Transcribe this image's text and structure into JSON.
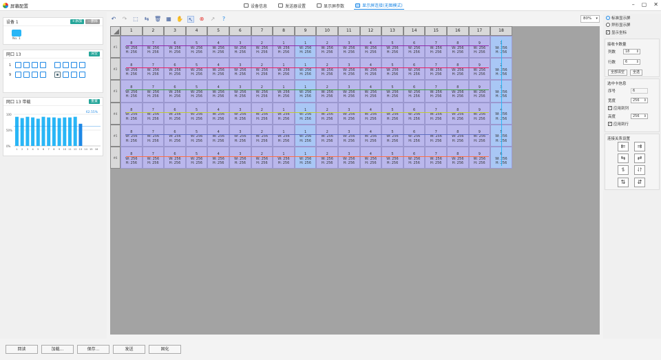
{
  "app": {
    "title": "屏幕配置"
  },
  "tabs": [
    {
      "label": "设备信息",
      "icon": "info-icon"
    },
    {
      "label": "发送器设置",
      "icon": "sender-icon"
    },
    {
      "label": "显示屏参数",
      "icon": "display-params-icon"
    },
    {
      "label": "显示屏连接(无图模式)",
      "icon": "display-connect-icon",
      "active": true
    }
  ],
  "left": {
    "device_card": {
      "title": "设备 1",
      "add_label": "+添加",
      "delete_label": "—删除",
      "device_label": "No. 1"
    },
    "port_card": {
      "title": "网口 13",
      "clear_label": "清空",
      "rows": [
        {
          "label": "1"
        },
        {
          "label": "9"
        }
      ]
    },
    "bandwidth_card": {
      "title": "网口 13 带载",
      "btn_label": "重置",
      "percent": "62.55%",
      "y_ticks": [
        "100",
        "50%",
        "0%"
      ],
      "x_ticks": [
        "1",
        "2",
        "3",
        "4",
        "5",
        "6",
        "7",
        "8",
        "9",
        "10",
        "11",
        "12",
        "13",
        "14",
        "15",
        "16"
      ]
    }
  },
  "toolbar": {
    "tools": [
      "undo-icon",
      "redo-icon",
      "select-area-icon",
      "auto-route-icon",
      "delete-icon",
      "layout-icon",
      "hand-icon",
      "pointer-icon",
      "clear-icon",
      "route-arrow-icon",
      "help-icon"
    ],
    "zoom": "80%"
  },
  "grid": {
    "columns": [
      "1",
      "2",
      "3",
      "4",
      "5",
      "6",
      "7",
      "8",
      "9",
      "10",
      "11",
      "12",
      "13",
      "14",
      "15",
      "16",
      "17",
      "18"
    ],
    "rows": [
      "#1",
      "#2",
      "#3",
      "#4",
      "#5",
      "#6"
    ],
    "cell_w_label": "W: 256",
    "cell_h_label": "H: 256",
    "row_numbers": [
      [
        "8",
        "7",
        "6",
        "5",
        "4",
        "3",
        "2",
        "1",
        "1",
        "2",
        "3",
        "4",
        "5",
        "6",
        "7",
        "8",
        "9",
        "1"
      ],
      [
        "8",
        "7",
        "6",
        "5",
        "4",
        "3",
        "2",
        "1",
        "1",
        "2",
        "3",
        "4",
        "5",
        "6",
        "7",
        "8",
        "9",
        "2"
      ],
      [
        "8",
        "7",
        "6",
        "5",
        "4",
        "3",
        "2",
        "1",
        "1",
        "2",
        "3",
        "4",
        "5",
        "6",
        "7",
        "8",
        "9",
        "3"
      ],
      [
        "8",
        "7",
        "6",
        "5",
        "4",
        "3",
        "2",
        "1",
        "1",
        "2",
        "3",
        "4",
        "5",
        "6",
        "7",
        "8",
        "9",
        "4"
      ],
      [
        "8",
        "7",
        "6",
        "5",
        "4",
        "3",
        "2",
        "1",
        "1",
        "2",
        "3",
        "4",
        "5",
        "6",
        "7",
        "8",
        "9",
        "5"
      ],
      [
        "8",
        "7",
        "6",
        "5",
        "4",
        "3",
        "2",
        "1",
        "1",
        "2",
        "3",
        "4",
        "5",
        "6",
        "7",
        "8",
        "9",
        "6"
      ]
    ]
  },
  "right": {
    "mode_standard": "标准显示屏",
    "mode_irregular": "异形显示屏",
    "show_grid": "显示坐标",
    "receiver_count": {
      "title": "接收卡数量",
      "cols_label": "列数",
      "cols_value": "18",
      "rows_label": "行数",
      "rows_value": "6",
      "clear_all": "全部清空",
      "select_all": "全选"
    },
    "selected_info": {
      "title": "选中卡信息",
      "index_label": "序号",
      "index_value": "6",
      "width_label": "宽度",
      "width_value": "256",
      "apply_col": "应用到列",
      "height_label": "高度",
      "height_value": "256",
      "apply_row": "应用到行"
    },
    "connection": {
      "title": "连接关系设置",
      "buttons": [
        "⇇",
        "⇉",
        "⇆",
        "⇄",
        "⥮",
        "⥯",
        "⇅",
        "⇵"
      ]
    }
  },
  "bottom_buttons": [
    "回读",
    "加载...",
    "保存...",
    "发送",
    "固化"
  ],
  "colors": {
    "cell": "#bab7ec",
    "canvas": "#a3a3a3",
    "accent": "#1e88e5",
    "vline": "#29b6f6"
  }
}
